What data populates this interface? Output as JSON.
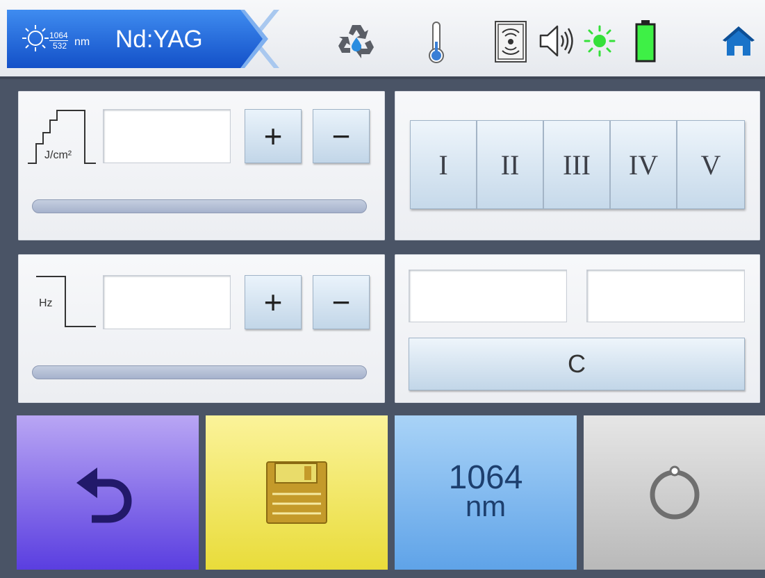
{
  "header": {
    "wavelength_top": "1064",
    "wavelength_bottom": "532",
    "wavelength_unit": "nm",
    "laser_name": "Nd:YAG",
    "icons": [
      "laser-sun-icon",
      "water-recycle-icon",
      "thermometer-icon",
      "sensor-icon",
      "speaker-icon",
      "light-status-icon",
      "battery-icon",
      "home-icon"
    ],
    "colors": {
      "brand_blue": "#1a5fd0",
      "status_green": "#35e03a",
      "home_blue": "#1a73c9"
    }
  },
  "fluence": {
    "unit_label": "J/cm²",
    "value": "",
    "plus": "+",
    "minus": "−"
  },
  "frequency": {
    "unit_label": "Hz",
    "value": "",
    "plus": "+",
    "minus": "−"
  },
  "levels": [
    "I",
    "II",
    "III",
    "IV",
    "V"
  ],
  "counter": {
    "field_a": "",
    "field_b": "",
    "clear_label": "C"
  },
  "bottom": {
    "back_icon": "undo-arrow-icon",
    "save_icon": "floppy-disk-icon",
    "wavelength_value": "1064",
    "wavelength_unit": "nm",
    "ready_icon": "power-ring-icon",
    "colors": {
      "back": "#7a5ce8",
      "save": "#f2e455",
      "wavelength": "#8ec2f2",
      "ready": "#c9c9c9"
    }
  }
}
